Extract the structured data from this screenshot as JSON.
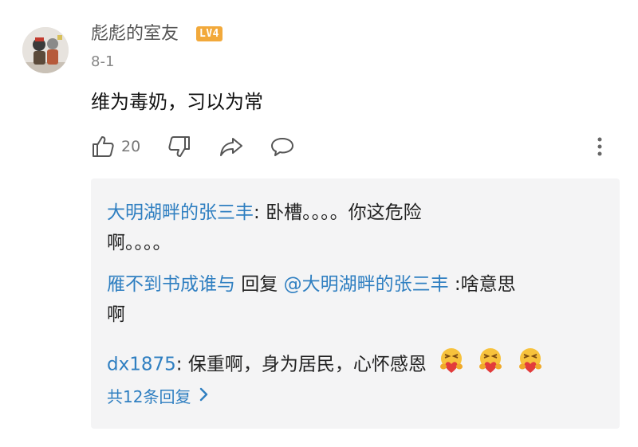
{
  "comment": {
    "username": "彪彪的室友",
    "level": "LV4",
    "timestamp": "8-1",
    "text": "维为毒奶，习以为常",
    "like_count": "20"
  },
  "icons": [
    "like-icon",
    "dislike-icon",
    "share-icon",
    "reply-icon",
    "more-icon",
    "hug-emoji-icon",
    "chevron-right-icon"
  ],
  "replies": [
    {
      "author": "大明湖畔的张三丰",
      "separator": ": ",
      "text_line1": "卧槽。。。。你这危险",
      "text_line2": "啊。。。。"
    },
    {
      "author": "雁不到书成谁与",
      "reply_word": " 回复 ",
      "mention": "@大明湖畔的张三丰",
      "text_line1": " :啥意思",
      "text_line2": "啊"
    },
    {
      "author": "dx1875",
      "separator": ": ",
      "text": "保重啊，身为居民，心怀感恩"
    }
  ],
  "more_replies_label": "共12条回复",
  "colors": {
    "link": "#2f7fc1",
    "badge": "#f2a93b",
    "reply_bg": "#f4f4f5",
    "icon": "#555555"
  }
}
